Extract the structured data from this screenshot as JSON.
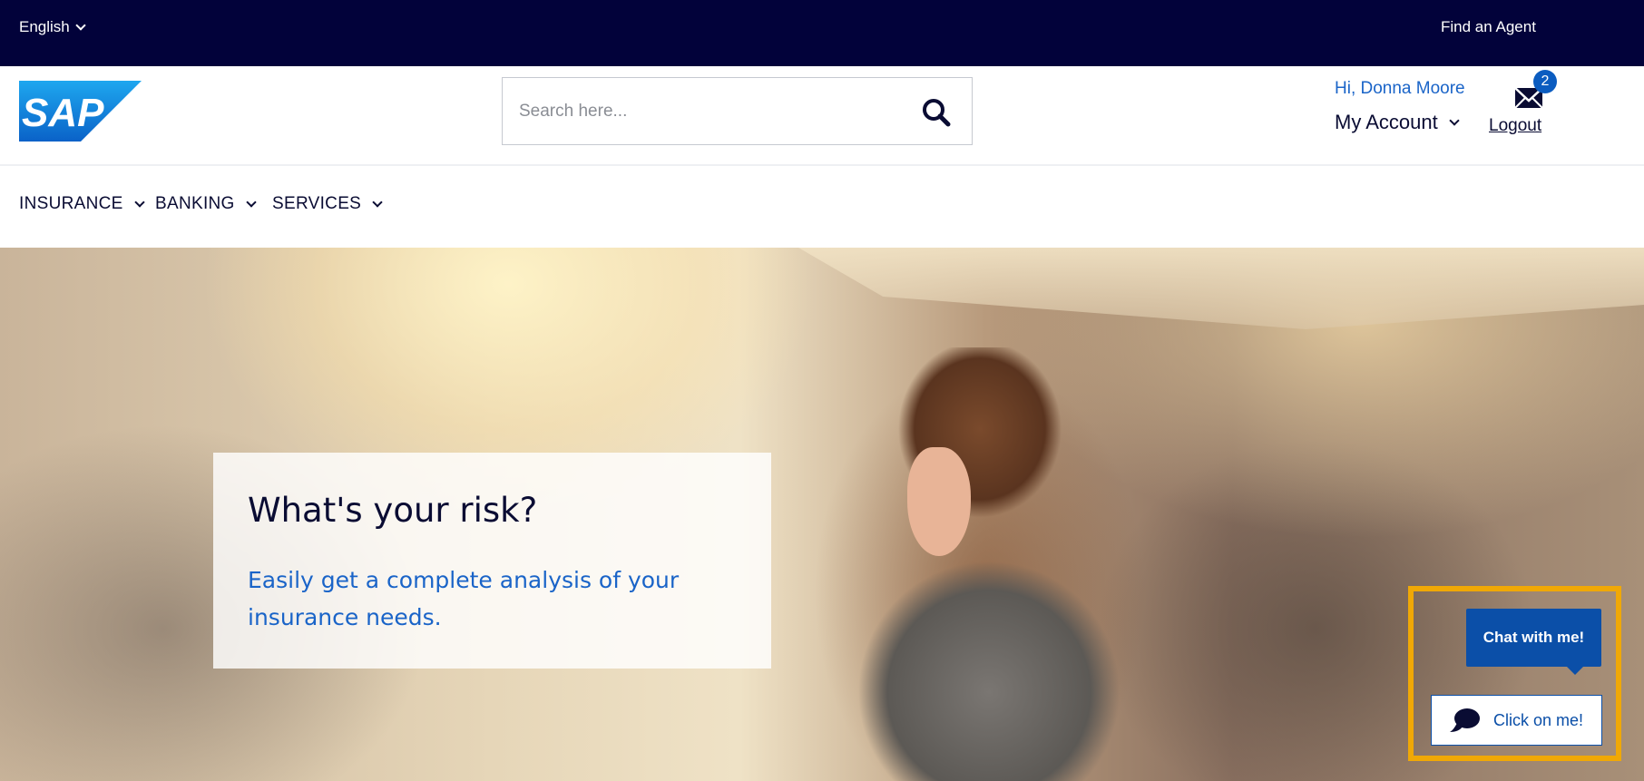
{
  "topbar": {
    "language": "English",
    "find_agent": "Find an Agent"
  },
  "header": {
    "logo_text": "SAP",
    "search": {
      "placeholder": "Search here...",
      "value": ""
    },
    "greeting": "Hi, Donna Moore",
    "account_label": "My Account",
    "inbox_count": "2",
    "logout_label": "Logout"
  },
  "nav": {
    "items": [
      {
        "label": "INSURANCE"
      },
      {
        "label": "BANKING"
      },
      {
        "label": "SERVICES"
      }
    ]
  },
  "hero": {
    "title": "What's your risk?",
    "subtitle": "Easily get a complete analysis of your insurance needs."
  },
  "chat": {
    "bubble_text": "Chat with me!",
    "button_label": "Click on me!"
  },
  "colors": {
    "topbar_bg": "#02023a",
    "accent_blue": "#1a64c8",
    "chat_blue": "#0b4fa8",
    "highlight_frame": "#f0a806"
  },
  "icons": [
    "chevron-down-icon",
    "search-icon",
    "mail-icon",
    "chat-bubble-icon"
  ]
}
